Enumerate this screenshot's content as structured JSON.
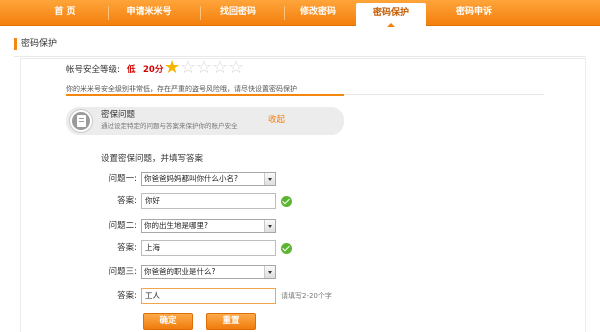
{
  "nav": {
    "items": [
      {
        "label": "首 页"
      },
      {
        "label": "申请米米号"
      },
      {
        "label": "找回密码"
      },
      {
        "label": "修改密码"
      },
      {
        "label": "密码保护",
        "active": true
      },
      {
        "label": "密码申诉"
      }
    ]
  },
  "section": {
    "title": "密码保护"
  },
  "security": {
    "label": "帐号安全等级:",
    "level": "低",
    "score": "20分",
    "stars_filled": 1,
    "stars_total": 5,
    "warning": "你的米米号安全级别非常低，存在严重的盗号风险哦，请尽快设置密码保护"
  },
  "qa_box": {
    "title": "密保问题",
    "desc": "通过设定特定的问题与答案来保护你的账户安全",
    "collapse_label": "收起",
    "icon": "document-icon"
  },
  "form": {
    "title": "设置密保问题，并填写答案",
    "rows": [
      {
        "q_label": "问题一:",
        "question": "你爸爸妈妈都叫你什么小名?",
        "a_label": "答案:",
        "answer": "你好",
        "valid": true
      },
      {
        "q_label": "问题二:",
        "question": "你的出生地是哪里?",
        "a_label": "答案:",
        "answer": "上海",
        "valid": true
      },
      {
        "q_label": "问题三:",
        "question": "你爸爸的职业是什么?",
        "a_label": "答案:",
        "answer": "工人",
        "valid": false,
        "hint": "请填写2-20个字"
      }
    ],
    "confirm_label": "确定",
    "reset_label": "重置"
  },
  "colors": {
    "accent": "#f3870f",
    "danger": "#d40000",
    "ok": "#5cb531"
  }
}
